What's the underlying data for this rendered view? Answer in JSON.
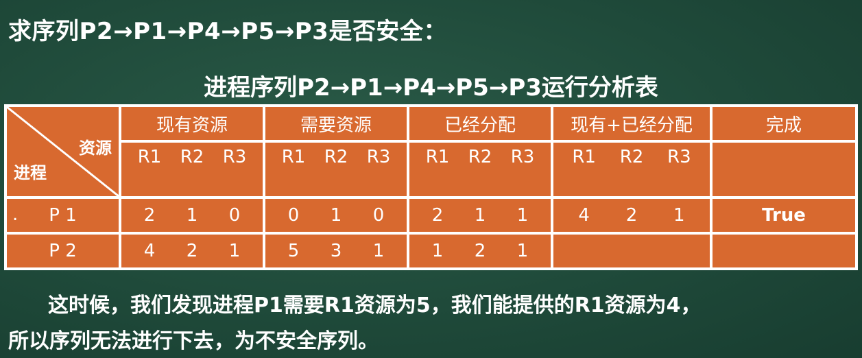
{
  "question": "求序列P2→P1→P4→P5→P3是否安全：",
  "table_title": "进程序列P2→P1→P4→P5→P3运行分析表",
  "corner": {
    "resource": "资源",
    "process": "进程"
  },
  "headers": [
    "现有资源",
    "需要资源",
    "已经分配",
    "现有+已经分配",
    "完成"
  ],
  "sub_headers": [
    "R1",
    "R2",
    "R3"
  ],
  "rows": [
    {
      "marker": ".",
      "proc": "P 1",
      "work": [
        "2",
        "1",
        "0"
      ],
      "need": [
        "0",
        "1",
        "0"
      ],
      "alloc": [
        "2",
        "1",
        "1"
      ],
      "sum": [
        "4",
        "2",
        "1"
      ],
      "finish": "True"
    },
    {
      "marker": "",
      "proc": "P 2",
      "work": [
        "4",
        "2",
        "1"
      ],
      "need": [
        "5",
        "3",
        "1"
      ],
      "alloc": [
        "1",
        "2",
        "1"
      ],
      "sum": [
        "",
        "",
        ""
      ],
      "finish": ""
    }
  ],
  "note_line1": "这时候，我们发现进程P1需要R1资源为5，我们能提供的R1资源为4，",
  "note_line2": "所以序列无法进行下去，为不安全序列。",
  "colors": {
    "board": "#1f4a3a",
    "cell": "#d8692f",
    "grid": "#ffffff"
  }
}
